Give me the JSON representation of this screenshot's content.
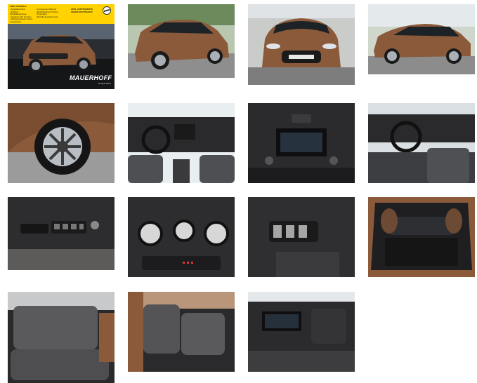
{
  "gallery": {
    "promo": {
      "banner_heading": "IHRE VORTEILE:",
      "banner_col1": "• Qualitätscheck\n• Erhöhte Mobilitätsgarantie\n• Garantie inkl. Service\n• Wiederverkaufs-Check Ausstattung",
      "banner_col2": "• Lückenlose Wartung\n• Mobilitätsfreie Prüfung\n• Probefahrt\n• Erstellungsparkservice",
      "badge_line1": "OPEL ZERTIFIZIERTE",
      "badge_line2": "GEBRAUCHTWAGEN",
      "dealer_name": "MAUERHOFF",
      "dealer_tagline": "mit Opel Karte",
      "plate_text": "OPEL ZERTIFIZIERTE GEBRAUCHTWAGEN"
    },
    "photos": [
      {
        "name": "photo-promo-front-three-quarter"
      },
      {
        "name": "photo-rear-three-quarter"
      },
      {
        "name": "photo-front"
      },
      {
        "name": "photo-side-profile"
      },
      {
        "name": "photo-wheel"
      },
      {
        "name": "photo-dashboard-from-rear"
      },
      {
        "name": "photo-center-console-infotainment"
      },
      {
        "name": "photo-driver-seat-steering"
      },
      {
        "name": "photo-door-panel-window-switches"
      },
      {
        "name": "photo-climate-controls"
      },
      {
        "name": "photo-headlight-switches"
      },
      {
        "name": "photo-trunk"
      },
      {
        "name": "photo-rear-seats"
      },
      {
        "name": "photo-front-seats-side"
      },
      {
        "name": "photo-dashboard-passenger-side"
      }
    ],
    "colors": {
      "car_paint": "#8a5a3a",
      "banner_yellow": "#ffd200",
      "interior_dark": "#2a2a2c",
      "seat_fabric": "#5a5a5c"
    }
  }
}
